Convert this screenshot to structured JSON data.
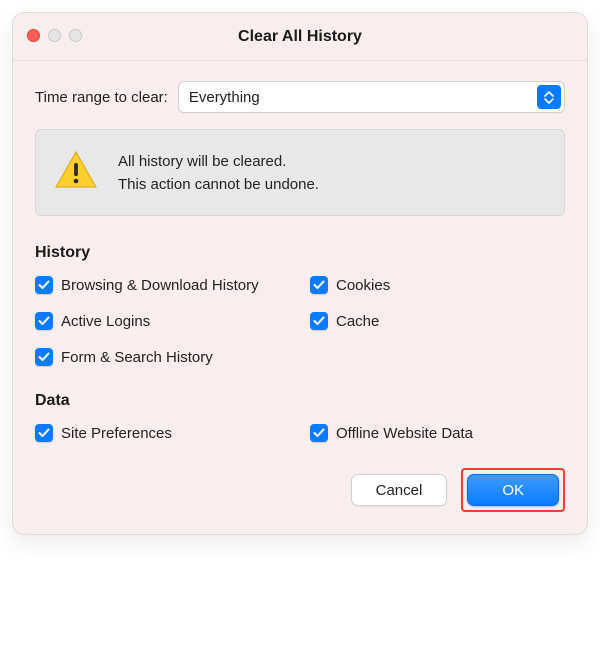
{
  "window": {
    "title": "Clear All History"
  },
  "range": {
    "label": "Time range to clear:",
    "selected": "Everything"
  },
  "warning": {
    "line1": "All history will be cleared.",
    "line2": "This action cannot be undone."
  },
  "sections": {
    "history": {
      "title": "History",
      "items": {
        "browsing": "Browsing & Download History",
        "cookies": "Cookies",
        "activeLogins": "Active Logins",
        "cache": "Cache",
        "formSearch": "Form & Search History"
      }
    },
    "data": {
      "title": "Data",
      "items": {
        "sitePrefs": "Site Preferences",
        "offlineData": "Offline Website Data"
      }
    }
  },
  "buttons": {
    "cancel": "Cancel",
    "ok": "OK"
  },
  "colors": {
    "accent": "#0a7bff",
    "windowBg": "#f8eeee",
    "highlight": "#ff3b30"
  }
}
